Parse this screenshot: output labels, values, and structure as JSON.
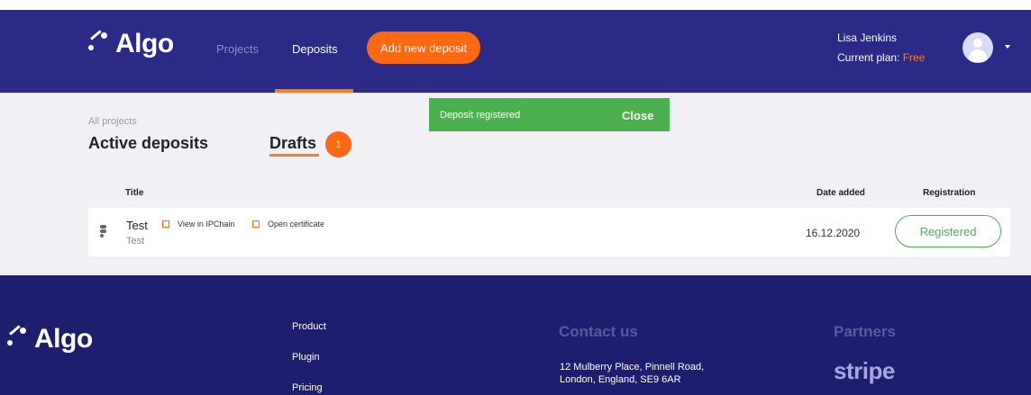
{
  "header": {
    "logo_text": "Algo",
    "nav": [
      {
        "label": "Projects",
        "active": false
      },
      {
        "label": "Deposits",
        "active": true
      }
    ],
    "add_button_label": "Add new deposit",
    "user": {
      "name": "Lisa Jenkins",
      "plan_prefix": "Current plan: ",
      "plan_value": "Free"
    }
  },
  "toast": {
    "message": "Deposit registered",
    "close_label": "Close",
    "color": "#4caf50"
  },
  "main": {
    "breadcrumb": "All projects",
    "tabs": [
      {
        "label": "Active deposits",
        "active": false
      },
      {
        "label": "Drafts",
        "active": true,
        "badge": "1"
      }
    ],
    "columns": {
      "title": "Title",
      "date": "Date added",
      "registration": "Registration"
    },
    "rows": [
      {
        "icon": "figma-icon",
        "title": "Test",
        "subtitle": "Test",
        "link_ipchain": "View in IPChain",
        "link_certificate": "Open certificate",
        "date": "16.12.2020",
        "status": "Registered"
      }
    ]
  },
  "footer": {
    "logo_text": "Algo",
    "links": [
      "Product",
      "Plugin",
      "Pricing"
    ],
    "contact_heading": "Contact us",
    "address_line1": "12 Mulberry Place, Pinnell Road,",
    "address_line2": "London, England, SE9 6AR",
    "partners_heading": "Partners",
    "partner": "stripe"
  },
  "colors": {
    "header_bg": "#2b2b87",
    "footer_bg": "#1e1e6e",
    "accent": "#fb6a12",
    "success": "#4caf50"
  }
}
